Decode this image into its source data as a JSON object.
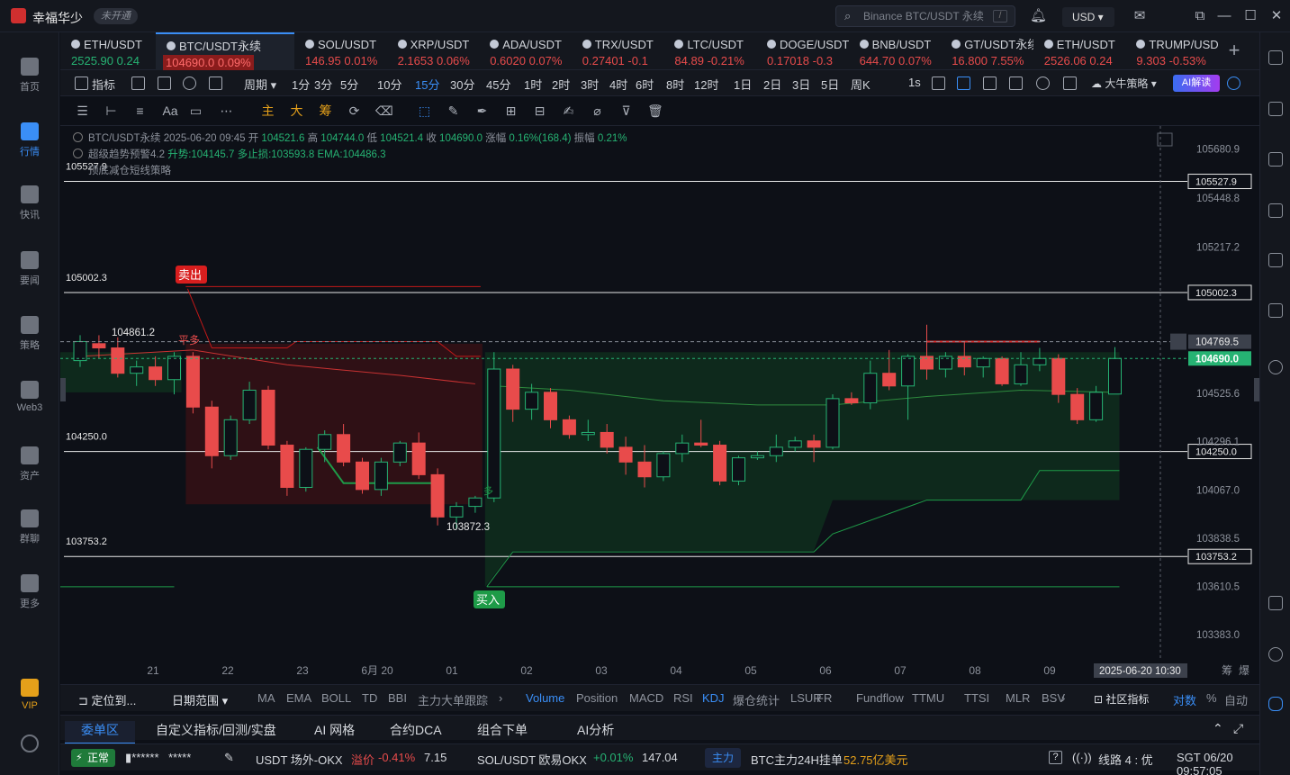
{
  "app": {
    "name": "幸福华少",
    "badge": "未开通"
  },
  "search": {
    "placeholder": "Binance BTC/USDT 永续",
    "shortcut": "/"
  },
  "header": {
    "currency": "USD"
  },
  "sidebar": [
    {
      "label": "首页",
      "icon": "home-icon"
    },
    {
      "label": "行情",
      "icon": "market-icon",
      "active": true
    },
    {
      "label": "快讯",
      "icon": "flash-news-icon"
    },
    {
      "label": "要闻",
      "icon": "news-icon"
    },
    {
      "label": "策略",
      "icon": "strategy-icon"
    },
    {
      "label": "Web3",
      "icon": "web3-icon"
    },
    {
      "label": "资产",
      "icon": "wallet-icon"
    },
    {
      "label": "群聊",
      "icon": "chat-icon"
    },
    {
      "label": "更多",
      "icon": "more-grid-icon"
    },
    {
      "label": "VIP",
      "icon": "vip-icon"
    }
  ],
  "tabs": [
    {
      "symbol": "ETH/USDT",
      "price": "2525.90",
      "change": "0.24",
      "dir": "up"
    },
    {
      "symbol": "BTC/USDT永续",
      "price": "104690.0",
      "change": "0.09%",
      "dir": "down",
      "active": true
    },
    {
      "symbol": "SOL/USDT",
      "price": "146.95",
      "change": "0.01%",
      "dir": "down"
    },
    {
      "symbol": "XRP/USDT",
      "price": "2.1653",
      "change": "0.06%",
      "dir": "down"
    },
    {
      "symbol": "ADA/USDT",
      "price": "0.6020",
      "change": "0.07%",
      "dir": "down"
    },
    {
      "symbol": "TRX/USDT",
      "price": "0.27401",
      "change": "-0.1",
      "dir": "down"
    },
    {
      "symbol": "LTC/USDT",
      "price": "84.89",
      "change": "-0.21%",
      "dir": "down"
    },
    {
      "symbol": "DOGE/USDT",
      "price": "0.17018",
      "change": "-0.3",
      "dir": "down"
    },
    {
      "symbol": "BNB/USDT",
      "price": "644.70",
      "change": "0.07%",
      "dir": "down"
    },
    {
      "symbol": "GT/USDT永续",
      "price": "16.800",
      "change": "7.55%",
      "dir": "down"
    },
    {
      "symbol": "ETH/USDT",
      "price": "2526.06",
      "change": "0.24",
      "dir": "down"
    },
    {
      "symbol": "TRUMP/USDT",
      "price": "9.303",
      "change": "-0.53%",
      "dir": "down"
    }
  ],
  "toolbar": {
    "indicator": "指标",
    "period": "周期",
    "timeframes": [
      "1分",
      "3分",
      "5分",
      "10分",
      "15分",
      "30分",
      "45分",
      "1时",
      "2时",
      "3时",
      "4时",
      "6时",
      "8时",
      "12时",
      "1日",
      "2日",
      "3日",
      "5日",
      "周K"
    ],
    "selected_timeframe": "15分",
    "interval_1s": "1s",
    "strategy": "大牛策略",
    "ai_button": "AI解读"
  },
  "drawing_tools": {
    "main": "主",
    "big": "大",
    "chip": "筹",
    "font": "Aa"
  },
  "legend": {
    "line1_symbol": "BTC/USDT永续",
    "line1_time": "2025-06-20 09:45",
    "open_label": "开",
    "open": "104521.6",
    "high_label": "高",
    "high": "104744.0",
    "low_label": "低",
    "low": "104521.4",
    "close_label": "收",
    "close": "104690.0",
    "change_label": "涨幅",
    "change": "0.16%(168.4)",
    "amp_label": "振幅",
    "amp": "0.21%",
    "line2_name": "超级趋势预警4.2",
    "line2_a": "升势:104145.7",
    "line2_b": "多止损:103593.8",
    "line2_c": "EMA:104486.3",
    "line3": "顶底减仓短线策略"
  },
  "chart_data": {
    "type": "candlestick",
    "title": "BTC/USDT永续",
    "ylim": [
      103260,
      105790
    ],
    "y_ticks": [
      "105680.9",
      "105448.8",
      "105217.2",
      "104525.6",
      "104296.1",
      "104067.0",
      "103838.5",
      "103610.5",
      "103383.0"
    ],
    "x_ticks": [
      "21",
      "22",
      "23",
      "6月 20",
      "01",
      "02",
      "03",
      "04",
      "05",
      "06",
      "07",
      "08",
      "09"
    ],
    "crosshair_time": "2025-06-20 10:30",
    "horizontal_levels": [
      "105527.9",
      "105002.3",
      "104250.0",
      "103753.2"
    ],
    "price_tags": {
      "hover": "104769.5",
      "last": "104690.0"
    },
    "annotations": {
      "sell": "卖出",
      "buy": "买入",
      "flat": "平多",
      "long": "多",
      "high_mark": "104861.2",
      "low_mark": "103872.3"
    },
    "candles": [
      [
        104680,
        104800,
        104650,
        104770
      ],
      [
        104760,
        104800,
        104690,
        104740
      ],
      [
        104740,
        104790,
        104600,
        104620
      ],
      [
        104620,
        104680,
        104560,
        104650
      ],
      [
        104650,
        104700,
        104560,
        104590
      ],
      [
        104590,
        104720,
        104520,
        104700
      ],
      [
        104700,
        104720,
        104430,
        104460
      ],
      [
        104460,
        104490,
        104170,
        104230
      ],
      [
        104230,
        104420,
        104210,
        104400
      ],
      [
        104400,
        104580,
        104380,
        104540
      ],
      [
        104540,
        104560,
        104260,
        104280
      ],
      [
        104280,
        104300,
        104040,
        104080
      ],
      [
        104080,
        104270,
        104060,
        104260
      ],
      [
        104260,
        104350,
        104200,
        104330
      ],
      [
        104330,
        104380,
        104180,
        104200
      ],
      [
        104200,
        104220,
        104050,
        104070
      ],
      [
        104070,
        104220,
        104040,
        104200
      ],
      [
        104200,
        104300,
        104180,
        104290
      ],
      [
        104290,
        104340,
        104120,
        104140
      ],
      [
        104140,
        104170,
        103900,
        103940
      ],
      [
        103940,
        104010,
        103880,
        103990
      ],
      [
        103990,
        104040,
        103960,
        104030
      ],
      [
        104030,
        104720,
        104010,
        104640
      ],
      [
        104640,
        104660,
        104390,
        104450
      ],
      [
        104450,
        104570,
        104400,
        104530
      ],
      [
        104530,
        104550,
        104360,
        104400
      ],
      [
        104400,
        104420,
        104310,
        104330
      ],
      [
        104330,
        104400,
        104300,
        104340
      ],
      [
        104340,
        104380,
        104240,
        104270
      ],
      [
        104270,
        104320,
        104140,
        104200
      ],
      [
        104200,
        104280,
        104080,
        104130
      ],
      [
        104130,
        104250,
        104110,
        104240
      ],
      [
        104240,
        104330,
        104200,
        104290
      ],
      [
        104290,
        104400,
        104270,
        104280
      ],
      [
        104280,
        104300,
        104090,
        104110
      ],
      [
        104110,
        104230,
        104090,
        104220
      ],
      [
        104220,
        104250,
        104210,
        104230
      ],
      [
        104230,
        104330,
        104200,
        104270
      ],
      [
        104270,
        104320,
        104250,
        104300
      ],
      [
        104300,
        104330,
        104200,
        104270
      ],
      [
        104270,
        104520,
        104260,
        104500
      ],
      [
        104500,
        104530,
        104470,
        104480
      ],
      [
        104480,
        104680,
        104450,
        104620
      ],
      [
        104620,
        104730,
        104540,
        104560
      ],
      [
        104560,
        104710,
        104400,
        104700
      ],
      [
        104700,
        104850,
        104590,
        104640
      ],
      [
        104640,
        104720,
        104600,
        104700
      ],
      [
        104700,
        104770,
        104610,
        104650
      ],
      [
        104650,
        104700,
        104600,
        104690
      ],
      [
        104690,
        104700,
        104560,
        104570
      ],
      [
        104570,
        104720,
        104560,
        104660
      ],
      [
        104660,
        104740,
        104630,
        104690
      ],
      [
        104690,
        104710,
        104480,
        104520
      ],
      [
        104520,
        104550,
        104380,
        104400
      ],
      [
        104400,
        104560,
        104390,
        104530
      ],
      [
        104521.6,
        104744,
        104521.4,
        104690
      ]
    ]
  },
  "indicators": {
    "locate": "定位到...",
    "date_range": "日期范围",
    "main_list": [
      "MA",
      "EMA",
      "BOLL",
      "TD",
      "BBI",
      "主力大单跟踪"
    ],
    "sub_list": [
      "Volume",
      "Position",
      "MACD",
      "RSI",
      "KDJ",
      "爆仓统计",
      "LSUR",
      "FR",
      "Fundflow",
      "TTMU",
      "TTSI",
      "MLR",
      "BSV"
    ],
    "selected": [
      "Volume",
      "KDJ"
    ],
    "community": "社区指标",
    "log": "对数",
    "pct": "%",
    "auto": "自动",
    "xaxis_extra": [
      "筹",
      "爆"
    ]
  },
  "panel_tabs": [
    "委单区",
    "自定义指标/回测/实盘",
    "AI 网格",
    "合约DCA",
    "组合下单",
    "AI分析"
  ],
  "status": {
    "normal": "正常",
    "account": "▮******",
    "masked": "*****",
    "usdt_label": "USDT 场外-OKX",
    "premium_label": "溢价",
    "premium": "-0.41%",
    "usdt_price": "7.15",
    "sol_label": "SOL/USDT 欧易OKX",
    "sol_change": "+0.01%",
    "sol_price": "147.04",
    "zhuli": "主力",
    "btc_label": "BTC主力24H挂单",
    "btc_value": "52.75亿美元",
    "line": "线路 4 : 优",
    "clock": "SGT 06/20 09:57:05"
  },
  "colors": {
    "up": "#26b373",
    "down": "#e84b4b",
    "accent": "#3a8ef6",
    "bg": "#0d1017"
  }
}
